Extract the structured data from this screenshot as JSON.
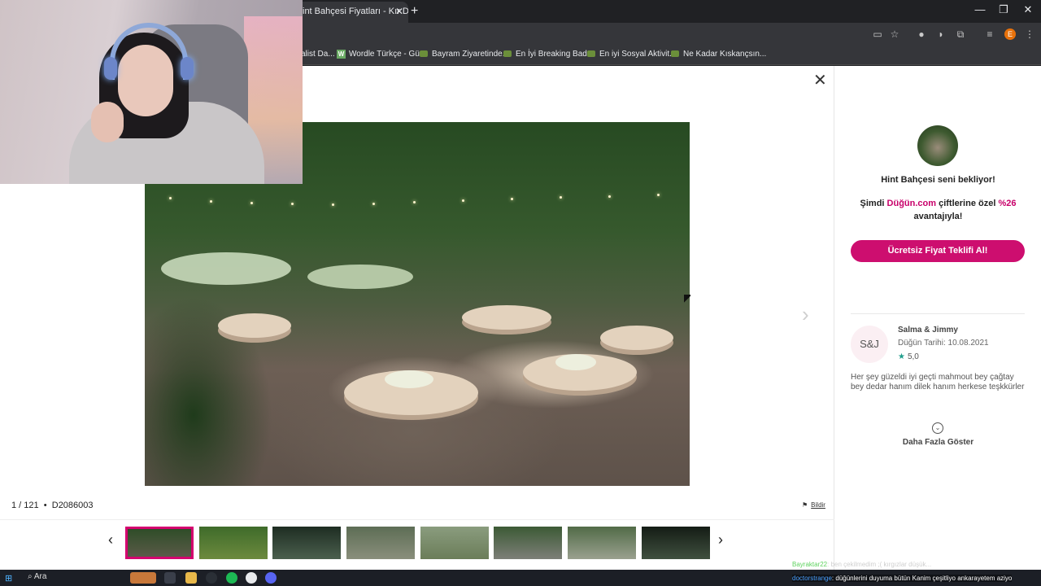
{
  "browser": {
    "tab_title": "int Bahçesi Fiyatları - Kır Düğü",
    "tab_close": "✕",
    "new_tab": "+",
    "window_controls": [
      "—",
      "❐",
      "✕"
    ],
    "profile_initial": "E",
    "bookmarks": [
      {
        "label": "alist Da..."
      },
      {
        "label": "Wordle Türkçe - Gü...",
        "icon": "W"
      },
      {
        "label": "Bayram Ziyaretinde..."
      },
      {
        "label": "En İyi Breaking Bad..."
      },
      {
        "label": "En iyi Sosyal Aktivit..."
      },
      {
        "label": "Ne Kadar Kıskançsın..."
      }
    ]
  },
  "gallery": {
    "close": "✕",
    "next_arrow": "›",
    "counter": "1 / 121",
    "separator": "•",
    "photo_code": "D2086003",
    "report_label": "Bildir",
    "strip_prev": "‹",
    "strip_next": "›",
    "thumbnail_count": 8
  },
  "sidebar": {
    "venue_headline": "Hint Bahçesi seni bekliyor!",
    "offer_prefix": "Şimdi",
    "offer_brand": "Düğün.com",
    "offer_mid": "çiftlerine özel",
    "offer_percent": "%26",
    "offer_suffix": "avantajıyla!",
    "cta_label": "Ücretsiz Fiyat Teklifi Al!",
    "review": {
      "initials": "S&J",
      "name": "Salma & Jimmy",
      "date": "Düğün Tarihi: 10.08.2021",
      "rating": "5,0",
      "text": "Her şey güzeldi iyi geçti mahmout bey çağtay bey dedar hanım dilek hanım herkese teşkkürler"
    },
    "more_label": "Daha Fazla Göster"
  },
  "taskbar": {
    "search_label": "Ara"
  },
  "overlay_chat": {
    "line1_user": "Bayraktar22",
    "line1_text": ": ben çekilmedim ;( kırgızlar düşük...",
    "line2_user": "doctorstrange",
    "line2_text": ": düğünlerini duyuma bütün Kanim çeşitliyo ankarayetem aziyo"
  },
  "colors": {
    "brand_pink": "#cd0e6f",
    "star_teal": "#1f9d8b"
  }
}
